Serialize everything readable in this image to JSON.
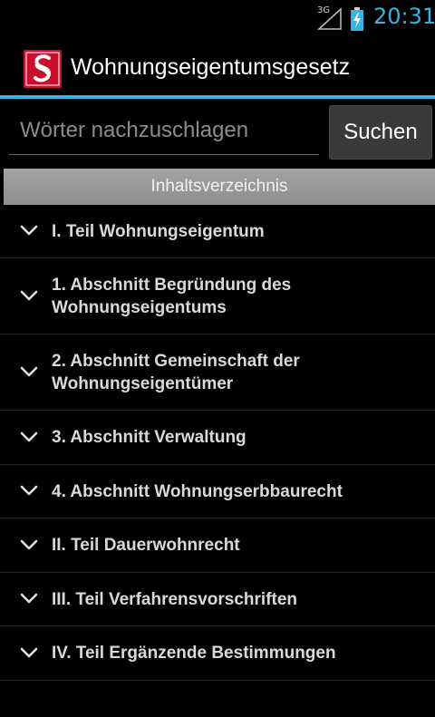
{
  "status_bar": {
    "network_label": "3G",
    "time": "20:31",
    "time_color": "#33b5e5",
    "icons": [
      "signal-icon",
      "battery-charging-icon"
    ]
  },
  "app": {
    "title": "Wohnungseigentumsgesetz",
    "icon": "paragraph-section-icon",
    "icon_color": "#c8102e"
  },
  "search": {
    "placeholder": "Wörter nachzuschlagen",
    "value": "",
    "button_label": "Suchen"
  },
  "toc": {
    "header": "Inhaltsverzeichnis",
    "items": [
      {
        "lines": [
          "I. Teil Wohnungseigentum"
        ]
      },
      {
        "lines": [
          "1. Abschnitt Begründung des",
          "Wohnungseigentums"
        ]
      },
      {
        "lines": [
          "2. Abschnitt Gemeinschaft der",
          "Wohnungseigentümer"
        ]
      },
      {
        "lines": [
          "3. Abschnitt Verwaltung"
        ]
      },
      {
        "lines": [
          "4. Abschnitt Wohnungserbbaurecht"
        ]
      },
      {
        "lines": [
          "II. Teil Dauerwohnrecht"
        ]
      },
      {
        "lines": [
          "III. Teil Verfahrensvorschriften"
        ]
      },
      {
        "lines": [
          "IV. Teil Ergänzende Bestimmungen"
        ]
      }
    ]
  },
  "colors": {
    "accent": "#33b5e5",
    "background": "#000000",
    "header_bar": "#9a9a9a"
  }
}
